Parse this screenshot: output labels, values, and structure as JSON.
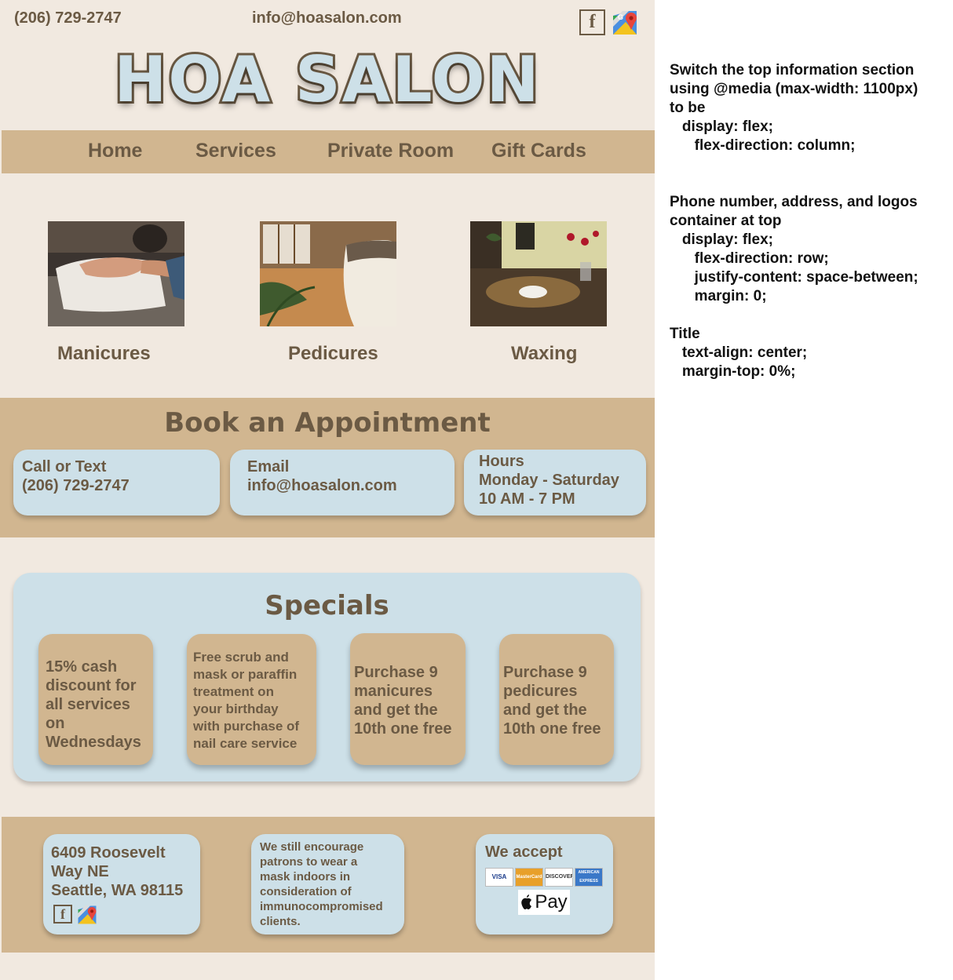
{
  "topbar": {
    "phone": "(206) 729-2747",
    "email": "info@hoasalon.com",
    "facebook_glyph": "f"
  },
  "title": "HOA SALON",
  "nav": {
    "items": [
      "Home",
      "Services",
      "Private Room",
      "Gift Cards"
    ]
  },
  "services": [
    {
      "label": "Manicures",
      "image": "manicure-photo"
    },
    {
      "label": "Pedicures",
      "image": "pedicure-room-photo"
    },
    {
      "label": "Waxing",
      "image": "waxing-room-photo"
    }
  ],
  "booking": {
    "title": "Book an Appointment",
    "cards": [
      {
        "lines": [
          "Call or Text",
          "(206) 729-2747"
        ]
      },
      {
        "lines": [
          "Email",
          "info@hoasalon.com"
        ]
      },
      {
        "lines": [
          "Hours",
          "Monday - Saturday",
          "10 AM - 7 PM"
        ]
      }
    ]
  },
  "specials": {
    "title": "Specials",
    "cards": [
      {
        "lines": [
          "15% cash",
          "discount for",
          "all services",
          "on",
          "Wednesdays"
        ]
      },
      {
        "lines": [
          "Free scrub and",
          "mask or paraffin",
          "treatment on",
          "your birthday",
          "with purchase of",
          "nail care service"
        ]
      },
      {
        "lines": [
          "Purchase 9",
          "manicures",
          "and get the",
          "10th one free"
        ]
      },
      {
        "lines": [
          "Purchase 9",
          "pedicures",
          "and get the",
          "10th one free"
        ]
      }
    ]
  },
  "footer": {
    "address": [
      "6409 Roosevelt",
      "Way NE",
      "Seattle, WA 98115"
    ],
    "notice": [
      "We still encourage",
      "patrons to wear a",
      "mask indoors in",
      "consideration of",
      "immunocompromised",
      "clients."
    ],
    "accept_title": "We accept",
    "cards": [
      "VISA",
      "MasterCard",
      "DISCOVER",
      "AMERICAN EXPRESS"
    ],
    "apple_pay": "Pay"
  },
  "notes": [
    "Switch the top information section",
    "using @media (max-width: 1100px)",
    "to be",
    "   display: flex;",
    "      flex-direction: column;",
    "",
    "",
    "Phone number, address, and logos",
    "container at top",
    "   display: flex;",
    "      flex-direction: row;",
    "      justify-content: space-between;",
    "      margin: 0;",
    "",
    "Title",
    "   text-align: center;",
    "   margin-top: 0%;"
  ],
  "colors": {
    "background": "#f1e9e0",
    "tan": "#d1b690",
    "light_blue": "#cde0e8",
    "brown": "#6b5a44"
  }
}
